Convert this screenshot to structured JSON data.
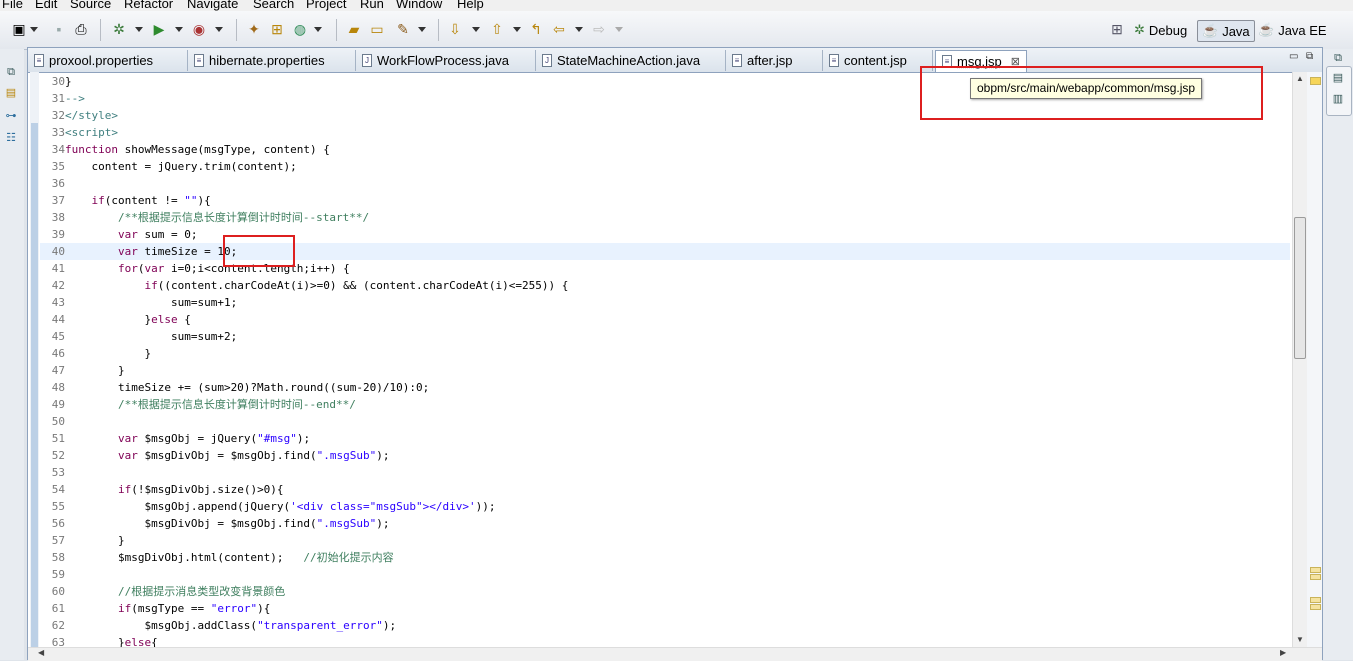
{
  "menu": [
    "File",
    "Edit",
    "Source",
    "Refactor",
    "Navigate",
    "Search",
    "Project",
    "Run",
    "Window",
    "Help"
  ],
  "perspectives": [
    {
      "label": "Debug",
      "active": false
    },
    {
      "label": "Java",
      "active": true
    },
    {
      "label": "Java EE",
      "active": false
    }
  ],
  "tabs": [
    {
      "label": "proxool.properties",
      "icon": "properties-file-icon"
    },
    {
      "label": "hibernate.properties",
      "icon": "properties-file-icon"
    },
    {
      "label": "WorkFlowProcess.java",
      "icon": "java-file-icon"
    },
    {
      "label": "StateMachineAction.java",
      "icon": "java-file-icon"
    },
    {
      "label": "after.jsp",
      "icon": "jsp-file-icon"
    },
    {
      "label": "content.jsp",
      "icon": "jsp-file-icon"
    },
    {
      "label": "msg.jsp",
      "icon": "jsp-file-icon",
      "active": true
    }
  ],
  "tooltip": "obpm/src/main/webapp/common/msg.jsp",
  "current_line": "40",
  "lines": [
    {
      "n": "30",
      "t": "}"
    },
    {
      "n": "31",
      "t": "-->"
    },
    {
      "n": "32",
      "t": "</style>"
    },
    {
      "n": "33",
      "t": "<script>"
    },
    {
      "n": "34",
      "t": "function showMessage(msgType, content) {"
    },
    {
      "n": "35",
      "t": "    content = jQuery.trim(content);"
    },
    {
      "n": "36",
      "t": ""
    },
    {
      "n": "37",
      "t": "    if(content != \"\"){"
    },
    {
      "n": "38",
      "t": "        /**根据提示信息长度计算倒计时时间--start**/"
    },
    {
      "n": "39",
      "t": "        var sum = 0;"
    },
    {
      "n": "40",
      "t": "        var timeSize = 10;"
    },
    {
      "n": "41",
      "t": "        for(var i=0;i<content.length;i++) {"
    },
    {
      "n": "42",
      "t": "            if((content.charCodeAt(i)>=0) && (content.charCodeAt(i)<=255)) {"
    },
    {
      "n": "43",
      "t": "                sum=sum+1;"
    },
    {
      "n": "44",
      "t": "            }else {"
    },
    {
      "n": "45",
      "t": "                sum=sum+2;"
    },
    {
      "n": "46",
      "t": "            }"
    },
    {
      "n": "47",
      "t": "        }"
    },
    {
      "n": "48",
      "t": "        timeSize += (sum>20)?Math.round((sum-20)/10):0;"
    },
    {
      "n": "49",
      "t": "        /**根据提示信息长度计算倒计时时间--end**/"
    },
    {
      "n": "50",
      "t": ""
    },
    {
      "n": "51",
      "t": "        var $msgObj = jQuery(\"#msg\");"
    },
    {
      "n": "52",
      "t": "        var $msgDivObj = $msgObj.find(\".msgSub\");"
    },
    {
      "n": "53",
      "t": ""
    },
    {
      "n": "54",
      "t": "        if(!$msgDivObj.size()>0){"
    },
    {
      "n": "55",
      "t": "            $msgObj.append(jQuery('<div class=\"msgSub\"></div>'));"
    },
    {
      "n": "56",
      "t": "            $msgDivObj = $msgObj.find(\".msgSub\");"
    },
    {
      "n": "57",
      "t": "        }"
    },
    {
      "n": "58",
      "t": "        $msgDivObj.html(content);   //初始化提示内容"
    },
    {
      "n": "59",
      "t": ""
    },
    {
      "n": "60",
      "t": "        //根据提示消息类型改变背景颜色"
    },
    {
      "n": "61",
      "t": "        if(msgType == \"error\"){"
    },
    {
      "n": "62",
      "t": "            $msgObj.addClass(\"transparent_error\");"
    },
    {
      "n": "63",
      "t": "        }else{"
    }
  ]
}
